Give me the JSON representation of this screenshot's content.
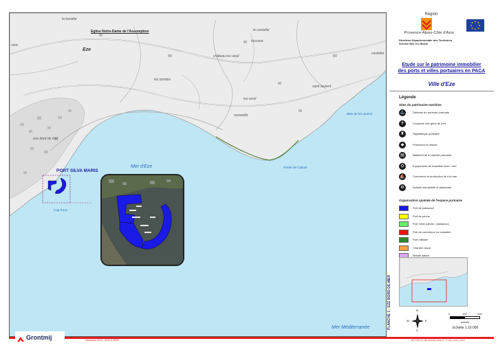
{
  "map": {
    "places": {
      "la_bandite": "la bandite",
      "eglise": "Eglise Notre-Dame de l'Assomption",
      "varic": "varic",
      "eze": "Eze",
      "le_castellar": "le castellar",
      "toscana": "toscana",
      "chateau": "château iou seuil",
      "les_bondes": "les bondes",
      "saint_laurent": "saint laurent",
      "iou_seuil": "iou seuil",
      "ravanella": "ravanella",
      "eze_bord_de_mer": "eze bord de mer",
      "castellet": "castellet"
    },
    "sea": {
      "mer_eze": "Mer d'Eze",
      "mer_med": "Mer Méditerranée"
    },
    "water_labels": {
      "baie": "Baie de St-Laurent",
      "pointe": "Pointe de Cabuel",
      "cap": "Cap Roux"
    },
    "port_name": "PORT SILVA MARIS"
  },
  "header": {
    "region_word": "Région",
    "region_name": "Provence-Alpes-Côte d'Azur",
    "direction_line1": "Direction Départementale des Territoires",
    "direction_line2": "Service Mer et Littoral",
    "study_title_line1": "Etude sur le patrimoine immobilier",
    "study_title_line2": "des ports et villes portuaires en PACA",
    "town": "Ville d'Eze"
  },
  "legend": {
    "title": "Légende",
    "section1": "Sites du patrimoine maritime",
    "icons": [
      {
        "label": "Défense du territoire portuaire",
        "icon": "anchor-icon"
      },
      {
        "label": "Croyance des gens de mer",
        "icon": "cross-icon"
      },
      {
        "label": "Signalétique portuaire",
        "icon": "lighthouse-icon"
      },
      {
        "label": "Protection du littoral",
        "icon": "shield-icon"
      },
      {
        "label": "Bâtiment lié à l'activité portuaire",
        "icon": "building-icon"
      },
      {
        "label": "Equipement de transition terre / mer",
        "icon": "crane-icon"
      },
      {
        "label": "Commerce et production lié à la mer",
        "icon": "boat-icon"
      },
      {
        "label": "Activité industrielle et artisanale",
        "icon": "factory-icon"
      }
    ],
    "section2": "Organisation spatiale de l'espace portuaire",
    "swatches": [
      {
        "label": "Port de plaisance",
        "color": "#1a1ae6"
      },
      {
        "label": "Port de pêche",
        "color": "#ffff00"
      },
      {
        "label": "Port mixte (pêche / plaisance)",
        "color": "#66ee66"
      },
      {
        "label": "Port de commerce ou industriel",
        "color": "#ee1111"
      },
      {
        "label": "Port militaire",
        "color": "#2a8a2a"
      },
      {
        "label": "Chantier naval",
        "color": "#f7a040"
      },
      {
        "label": "Marais salant",
        "color": "#d9a8f0"
      }
    ]
  },
  "scale": {
    "n0": "0",
    "n1": "100",
    "n2": "200",
    "unit": "mètres",
    "ratio": "Echelle 1:10 000"
  },
  "north_letters": {
    "n": "N",
    "s": "S",
    "e": "E",
    "w": "W"
  },
  "planche": "PLANCHE 1 : EZE BORD-DE-MER",
  "footer": {
    "company": "Grontmij",
    "left": "Novembre 2010 - HYCLE R009",
    "right": "BD TOPO ® - BD PARCELLAIRE ® - © IGN - Paris - 2010"
  },
  "colors": {
    "sea": "#bfe6f5",
    "land": "#ececec",
    "port": "#1a1ae6",
    "accent": "#e41e1e",
    "title_blue": "#1a1a9a"
  }
}
